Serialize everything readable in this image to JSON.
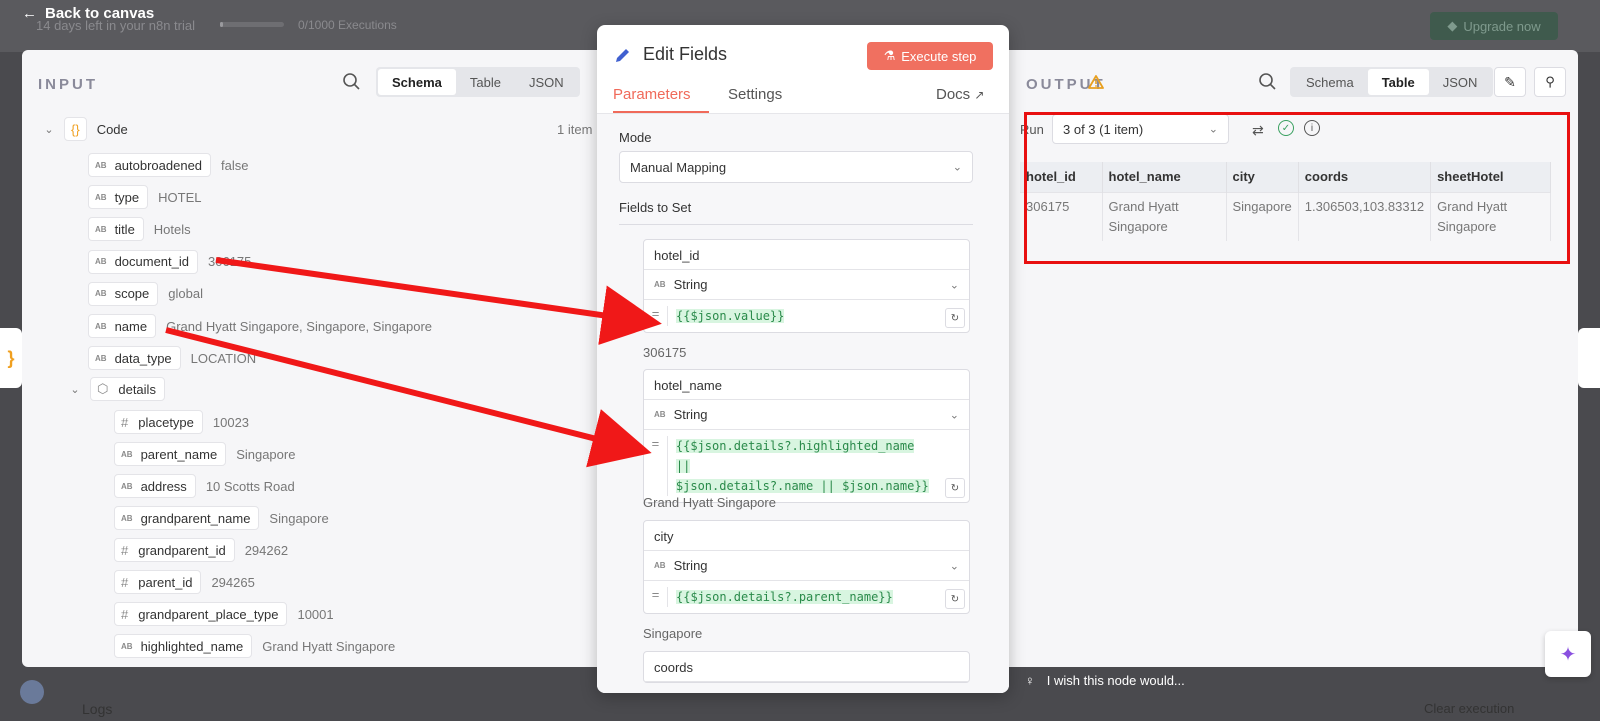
{
  "topbar": {
    "trial_text": "14 days left in your n8n trial",
    "exec_count": "0/1000 Executions",
    "upgrade_label": "Upgrade now",
    "back_label": "Back to canvas"
  },
  "input": {
    "title": "INPUT",
    "tabs": [
      "Schema",
      "Table",
      "JSON"
    ],
    "active_tab": "Schema",
    "root": {
      "label": "Code",
      "count": "1 item"
    },
    "fields": [
      {
        "type": "AB",
        "name": "autobroadened",
        "value": "false"
      },
      {
        "type": "AB",
        "name": "type",
        "value": "HOTEL"
      },
      {
        "type": "AB",
        "name": "title",
        "value": "Hotels"
      },
      {
        "type": "AB",
        "name": "document_id",
        "value": "306175"
      },
      {
        "type": "AB",
        "name": "scope",
        "value": "global"
      },
      {
        "type": "AB",
        "name": "name",
        "value": "Grand Hyatt Singapore, Singapore, Singapore"
      },
      {
        "type": "AB",
        "name": "data_type",
        "value": "LOCATION"
      }
    ],
    "details": {
      "label": "details",
      "fields": [
        {
          "type": "#",
          "name": "placetype",
          "value": "10023"
        },
        {
          "type": "AB",
          "name": "parent_name",
          "value": "Singapore"
        },
        {
          "type": "AB",
          "name": "address",
          "value": "10 Scotts Road"
        },
        {
          "type": "AB",
          "name": "grandparent_name",
          "value": "Singapore"
        },
        {
          "type": "#",
          "name": "grandparent_id",
          "value": "294262"
        },
        {
          "type": "#",
          "name": "parent_id",
          "value": "294265"
        },
        {
          "type": "#",
          "name": "grandparent_place_type",
          "value": "10001"
        },
        {
          "type": "AB",
          "name": "highlighted_name",
          "value": "Grand Hyatt Singapore"
        }
      ]
    }
  },
  "edit": {
    "title": "Edit Fields",
    "execute_label": "Execute step",
    "tabs": {
      "parameters": "Parameters",
      "settings": "Settings",
      "docs": "Docs"
    },
    "mode_label": "Mode",
    "mode_value": "Manual Mapping",
    "fields_label": "Fields to Set",
    "assignments": [
      {
        "name": "hotel_id",
        "type": "String",
        "expr": [
          "{{$json.value}}"
        ],
        "result": "306175"
      },
      {
        "name": "hotel_name",
        "type": "String",
        "expr": [
          "{{$json.details?.highlighted_name ||",
          "$json.details?.name || $json.name}}"
        ],
        "result": "Grand Hyatt Singapore"
      },
      {
        "name": "city",
        "type": "String",
        "expr": [
          "{{$json.details?.parent_name}}"
        ],
        "result": "Singapore"
      },
      {
        "name": "coords"
      }
    ]
  },
  "output": {
    "title": "OUTPUT",
    "tabs": [
      "Schema",
      "Table",
      "JSON"
    ],
    "active_tab": "Table",
    "run_label": "Run",
    "run_value": "3 of 3 (1 item)",
    "columns": [
      "hotel_id",
      "hotel_name",
      "city",
      "coords",
      "sheetHotel"
    ],
    "rows": [
      {
        "hotel_id": "306175",
        "hotel_name": "Grand Hyatt Singapore",
        "city": "Singapore",
        "coords": "1.306503,103.83312",
        "sheetHotel": "Grand Hyatt Singapore"
      }
    ]
  },
  "footer": {
    "wish_text": "I wish this node would...",
    "logs_label": "Logs",
    "clear_label": "Clear execution"
  },
  "colors": {
    "accent": "#f06a5a",
    "highlight": "#e81010",
    "code_green": "#2a8a4a"
  }
}
